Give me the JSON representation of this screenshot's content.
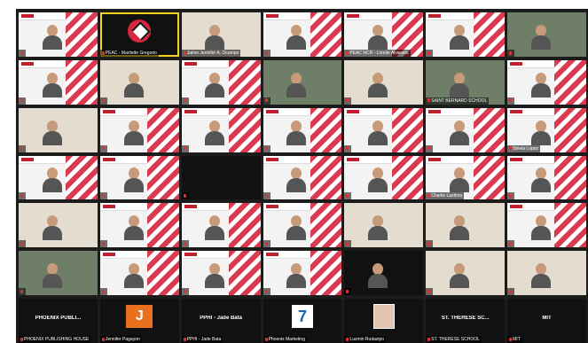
{
  "tiles": [
    {
      "name": "",
      "kind": "slide",
      "person": true
    },
    {
      "name": "PEAC - Marilette Gregorio",
      "kind": "dark",
      "logo": "peac-logo-icon",
      "active": true
    },
    {
      "name": "Jaime Jennifer A. Ocampo",
      "kind": "home",
      "person": true
    },
    {
      "name": "",
      "kind": "slide",
      "person": true
    },
    {
      "name": "PEAC NCR - Lorelie Alvarado",
      "kind": "slide",
      "person": true
    },
    {
      "name": "",
      "kind": "slide",
      "person": true
    },
    {
      "name": "",
      "kind": "outdoor",
      "person": true
    },
    {
      "name": "",
      "kind": "slide",
      "person": true
    },
    {
      "name": "",
      "kind": "home",
      "person": true
    },
    {
      "name": "",
      "kind": "slide",
      "person": true
    },
    {
      "name": "",
      "kind": "outdoor",
      "person": true
    },
    {
      "name": "",
      "kind": "home",
      "person": true
    },
    {
      "name": "SAINT BERNARD SCHOOL",
      "kind": "outdoor",
      "person": true
    },
    {
      "name": "",
      "kind": "slide",
      "person": true
    },
    {
      "name": "",
      "kind": "home",
      "person": true
    },
    {
      "name": "",
      "kind": "slide",
      "person": true
    },
    {
      "name": "",
      "kind": "slide",
      "person": true
    },
    {
      "name": "",
      "kind": "slide",
      "person": true
    },
    {
      "name": "",
      "kind": "slide",
      "person": true
    },
    {
      "name": "",
      "kind": "slide",
      "person": true
    },
    {
      "name": "Shiela Lopez",
      "kind": "slide",
      "person": true
    },
    {
      "name": "",
      "kind": "slide",
      "person": true
    },
    {
      "name": "",
      "kind": "slide",
      "person": true
    },
    {
      "name": "",
      "kind": "dark",
      "person": false
    },
    {
      "name": "",
      "kind": "slide",
      "person": true
    },
    {
      "name": "",
      "kind": "slide",
      "person": true
    },
    {
      "name": "Charlie Lastima",
      "kind": "slide",
      "person": true
    },
    {
      "name": "",
      "kind": "slide",
      "person": true
    },
    {
      "name": "",
      "kind": "home",
      "person": true
    },
    {
      "name": "",
      "kind": "slide",
      "person": true
    },
    {
      "name": "",
      "kind": "slide",
      "person": true
    },
    {
      "name": "",
      "kind": "slide",
      "person": true
    },
    {
      "name": "",
      "kind": "home",
      "person": true
    },
    {
      "name": "",
      "kind": "home",
      "person": true
    },
    {
      "name": "",
      "kind": "slide",
      "person": true
    },
    {
      "name": "",
      "kind": "outdoor",
      "person": true
    },
    {
      "name": "",
      "kind": "slide",
      "person": true
    },
    {
      "name": "",
      "kind": "slide",
      "person": true
    },
    {
      "name": "",
      "kind": "slide",
      "person": true
    },
    {
      "name": "",
      "kind": "dark",
      "person": true
    },
    {
      "name": "",
      "kind": "home",
      "person": true
    },
    {
      "name": "",
      "kind": "home",
      "person": true
    },
    {
      "name": "PHOENIX PUBLISHING HOUSE",
      "kind": "dark",
      "center": "PHOENIX PUBLI..."
    },
    {
      "name": "Jennifer Pagayon",
      "kind": "dark",
      "logo": "j-logo-icon"
    },
    {
      "name": "PPHI - Jade Bata",
      "kind": "dark",
      "center": "PPHI - Jade Bata"
    },
    {
      "name": "Phoenix Marketing",
      "kind": "dark",
      "logo": "seven-logo-icon"
    },
    {
      "name": "Luzmin Rudazipo",
      "kind": "dark",
      "logo": "portrait-icon"
    },
    {
      "name": "ST. THERESE SCHOOL",
      "kind": "dark",
      "center": "ST. THERESE SC..."
    },
    {
      "name": "MIT",
      "kind": "dark",
      "center": "MIT"
    }
  ],
  "colors": {
    "background": "#1c1c1c",
    "active_speaker": "#f2d21b",
    "peac_red": "#d7263d",
    "muted_mic": "#e03030"
  }
}
